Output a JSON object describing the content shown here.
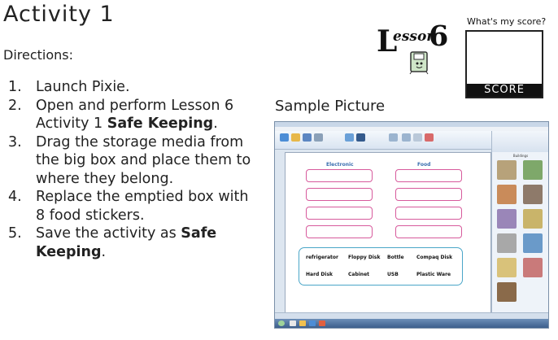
{
  "title": "Activity 1",
  "directions": "Directions:",
  "steps": [
    {
      "num": "1.",
      "parts": [
        {
          "t": "Launch Pixie.",
          "b": false
        }
      ]
    },
    {
      "num": "2.",
      "parts": [
        {
          "t": "Open and perform Lesson 6 Activity 1 ",
          "b": false
        },
        {
          "t": "Safe Keeping",
          "b": true
        },
        {
          "t": ".",
          "b": false
        }
      ]
    },
    {
      "num": "3.",
      "parts": [
        {
          "t": "Drag the storage media from the big  box and place them to where they belong.",
          "b": false
        }
      ]
    },
    {
      "num": "4.",
      "parts": [
        {
          "t": "Replace the emptied box with 8 food stickers.",
          "b": false
        }
      ]
    },
    {
      "num": "5.",
      "parts": [
        {
          "t": "Save the activity as ",
          "b": false
        },
        {
          "t": "Safe Keeping",
          "b": true
        },
        {
          "t": ".",
          "b": false
        }
      ]
    }
  ],
  "lesson_logo": {
    "letter": "L",
    "word": "esson",
    "number": "6"
  },
  "score": {
    "question": "What's my score?",
    "label": "SCORE"
  },
  "sample_label": "Sample Picture",
  "screenshot": {
    "columns": [
      "Electronic",
      "Food"
    ],
    "words_row1": [
      "refrigerator",
      "Floppy Disk",
      "Bottle",
      "Compaq Disk"
    ],
    "words_row2": [
      "Hard Disk",
      "Cabinet",
      "USB",
      "Plastic Ware"
    ],
    "sidebar_title": "Buildings",
    "colors": {
      "pill_border": "#d75a9c",
      "box_border": "#4aa6c8",
      "heading": "#3b6fb0"
    }
  }
}
